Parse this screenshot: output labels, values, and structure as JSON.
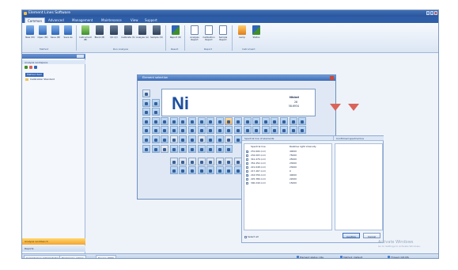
{
  "window": {
    "title": "Element Lines Software"
  },
  "tabs": [
    "Common",
    "Advanced",
    "Management",
    "Maintenance",
    "View",
    "Support"
  ],
  "ribbon": {
    "groups": [
      {
        "label": "Method",
        "buttons": [
          "New (M)",
          "Open (M)",
          "Save (M)",
          "Save As"
        ]
      },
      {
        "label": "Run Analysis",
        "buttons": [
          "Instrument (M)",
          "Blank (B)",
          "QC (Q)",
          "Calibrate (S)",
          "Analyze (A)",
          "Sample (D)"
        ]
      },
      {
        "label": "Result",
        "buttons": [
          "Report (R)"
        ]
      },
      {
        "label": "Report",
        "buttons": [
          "Analysis Report",
          "Calibration Report",
          "Sample Report"
        ]
      },
      {
        "label": "Instrument",
        "buttons": [
          "Lamp",
          "Status"
        ]
      }
    ]
  },
  "left_panel": {
    "header": "Analysis workspace",
    "tree": [
      {
        "label": "Method Item",
        "selected": true
      },
      {
        "label": "Calibration Standard",
        "selected": false
      }
    ],
    "nav": [
      {
        "label": "Analysis workbench",
        "active": true
      },
      {
        "label": "Reports",
        "active": false
      }
    ]
  },
  "periodic_dialog": {
    "title": "Element selection",
    "selected_element": {
      "symbol": "Ni",
      "name": "Nickel",
      "number": "28",
      "mass": "58.6934"
    }
  },
  "spectral_dialog": {
    "left_header": "Spectral line of elements",
    "right_header": "Confirmed spectral line",
    "col_wavelength": "Spectral line",
    "col_intensity": "Relative light intensity",
    "rows": [
      {
        "wavelength": "231.604 (nm)",
        "intensity": "40000",
        "checked": true
      },
      {
        "wavelength": "232.003 (nm)",
        "intensity": "75000",
        "checked": false
      },
      {
        "wavelength": "341.476 (nm)",
        "intensity": "25000",
        "checked": false
      },
      {
        "wavelength": "352.454 (nm)",
        "intensity": "23000",
        "checked": false
      },
      {
        "wavelength": "221.648 (nm)",
        "intensity": "23000",
        "checked": false
      },
      {
        "wavelength": "217.467 (nm)",
        "intensity": "0",
        "checked": false
      },
      {
        "wavelength": "216.556 (nm)",
        "intensity": "40000",
        "checked": true
      },
      {
        "wavelength": "225.386 (nm)",
        "intensity": "22000",
        "checked": false
      },
      {
        "wavelength": "300.249 (nm)",
        "intensity": "15000",
        "checked": false
      }
    ],
    "select_all": "Select all",
    "confirm": "Confirm",
    "cancel": "Cancel"
  },
  "status_bar": {
    "items": [
      "Current User: Administrator",
      "Permission: Admin",
      "Device: WHD",
      "Element status: Idle",
      "Method: Default",
      "Thread: ICP-MS"
    ]
  },
  "watermark": {
    "line1": "Activate Windows",
    "line2": "Go to Settings to activate Windows."
  },
  "colors": {
    "accent": "#2f66b8",
    "highlight": "#f3b35a",
    "arrow": "#d9645a",
    "titlebar": "#3f6fb6"
  }
}
